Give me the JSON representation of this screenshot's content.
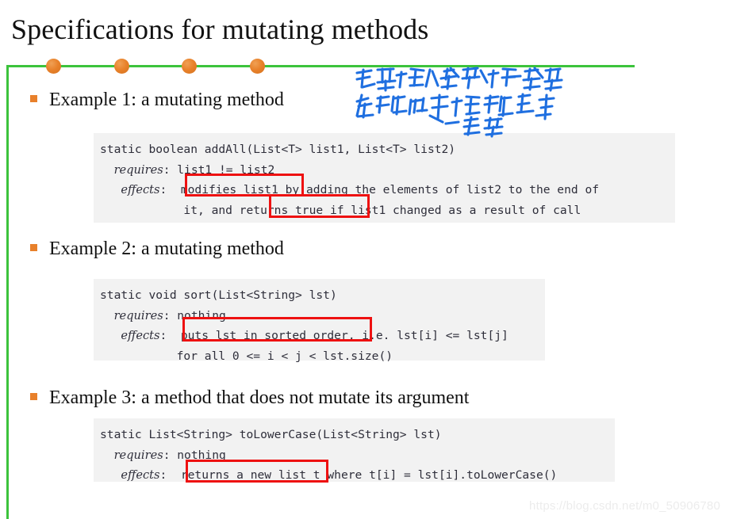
{
  "slide": {
    "title": "Specifications for mutating methods",
    "watermark": "https://blog.csdn.net/m0_50906780",
    "accent_green": "#3cc33c",
    "accent_orange": "#e8802b",
    "annotation_red": "#ee1111",
    "code_background": "#f2f2f2"
  },
  "decoration": {
    "dots": [
      {
        "name": "rule-dot-1"
      },
      {
        "name": "rule-dot-2"
      },
      {
        "name": "rule-dot-3"
      },
      {
        "name": "rule-dot-4"
      }
    ]
  },
  "bullets": [
    {
      "label": "Example 1: a mutating method"
    },
    {
      "label": "Example 2: a mutating method"
    },
    {
      "label": "Example 3: a method that does not mutate its argument"
    }
  ],
  "code_blocks": [
    {
      "id": "addAll",
      "lines": [
        {
          "signature": "static boolean addAll(List<T> list1, List<T> list2)"
        },
        {
          "keyword": "requires",
          "rest": ": list1 != list2"
        },
        {
          "keyword": "effects",
          "rest": ":  modifies list1 by adding the elements of list2 to the end of"
        },
        {
          "continuation": "            it, and returns true if list1 changed as a result of call"
        }
      ],
      "highlights": [
        "modifies list1",
        "returns true"
      ]
    },
    {
      "id": "sort",
      "lines": [
        {
          "signature": "static void sort(List<String> lst)"
        },
        {
          "keyword": "requires",
          "rest": ": nothing"
        },
        {
          "keyword": "effects",
          "rest": ":  puts lst in sorted order, i.e. lst[i] <= lst[j]"
        },
        {
          "continuation": "           for all 0 <= i < j < lst.size()"
        }
      ],
      "highlights": [
        "puts lst in sorted order,"
      ]
    },
    {
      "id": "toLowerCase",
      "lines": [
        {
          "signature": "static List<String> toLowerCase(List<String> lst)"
        },
        {
          "keyword": "requires",
          "rest": ": nothing"
        },
        {
          "keyword": "effects",
          "rest": ":  returns a new list t where t[i] = lst[i].toLowerCase()"
        }
      ],
      "highlights": [
        "returns a new list"
      ]
    }
  ],
  "handwriting": {
    "line1": "如果对输入参数作改变",
    "line2": "在规约中体现出来",
    "line3": "一定要",
    "color": "#1f6fe0"
  }
}
